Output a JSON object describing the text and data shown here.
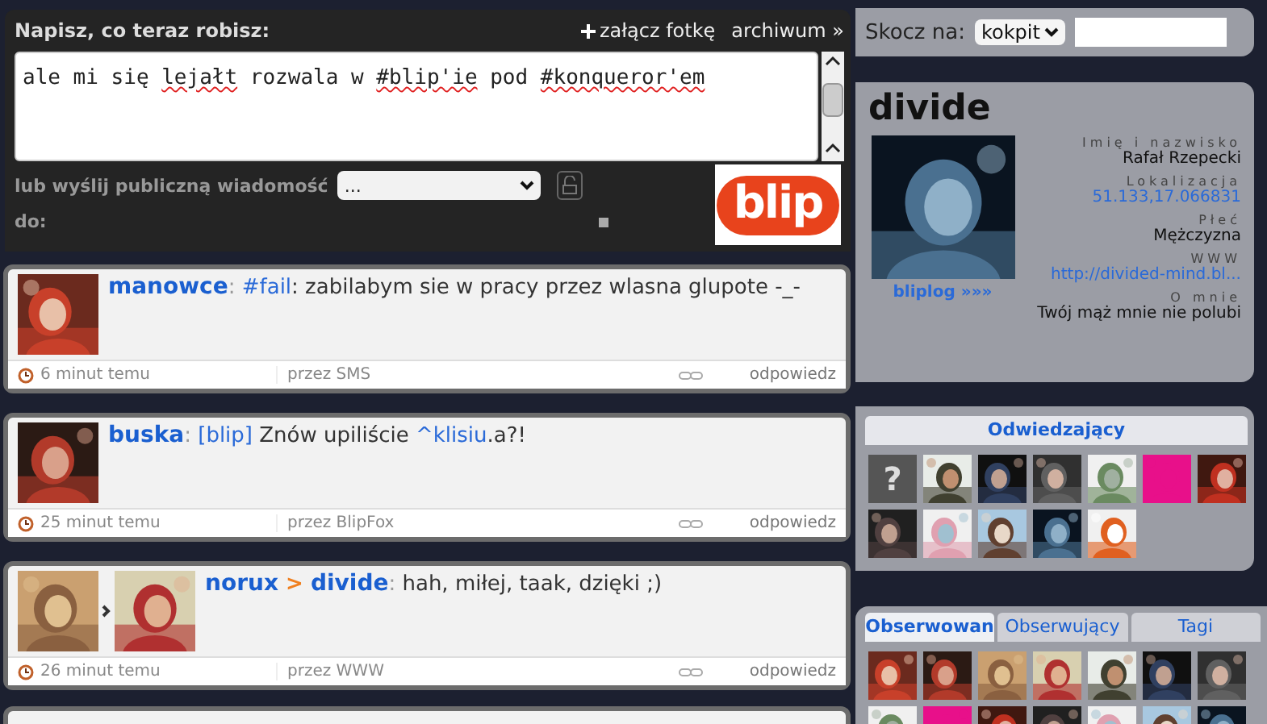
{
  "compose": {
    "title": "Napisz, co teraz robisz:",
    "attach": "załącz fotkę",
    "archive": "archiwum »",
    "message": [
      {
        "text": "ale mi się ",
        "misspelled": false
      },
      {
        "text": "lejałt",
        "misspelled": true
      },
      {
        "text": " rozwala w ",
        "misspelled": false
      },
      {
        "text": "#blip'ie",
        "misspelled": true
      },
      {
        "text": " pod ",
        "misspelled": false
      },
      {
        "text": "#konqueror'em",
        "misspelled": true
      }
    ],
    "recipient_label": "lub wyślij publiczną wiadomość",
    "recipient_select": "...",
    "to_label": "do:"
  },
  "logo": "blip",
  "posts": [
    {
      "avatars": [
        {
          "kind": "picture"
        }
      ],
      "message": [
        {
          "kind": "author",
          "text": "manowce"
        },
        {
          "kind": "sep",
          "text": ":"
        },
        {
          "kind": "link",
          "text": " #fail"
        },
        {
          "kind": "plain",
          "text": ": zabilabym sie w pracy przez wlasna glupote -_-"
        }
      ],
      "time": "6 minut temu",
      "source": "przez SMS",
      "reply": "odpowiedz"
    },
    {
      "avatars": [
        {
          "kind": "picture"
        }
      ],
      "message": [
        {
          "kind": "author",
          "text": "buska"
        },
        {
          "kind": "sep",
          "text": ":"
        },
        {
          "kind": "link",
          "text": " [blip]"
        },
        {
          "kind": "plain",
          "text": " Znów upiliście "
        },
        {
          "kind": "link",
          "text": "^klisiu"
        },
        {
          "kind": "plain",
          "text": ".a?!"
        }
      ],
      "time": "25 minut temu",
      "source": "przez BlipFox",
      "reply": "odpowiedz"
    },
    {
      "avatars": [
        {
          "kind": "picture"
        },
        {
          "kind": "picture"
        }
      ],
      "message": [
        {
          "kind": "author",
          "text": "norux"
        },
        {
          "kind": "arrow",
          "text": " > "
        },
        {
          "kind": "author",
          "text": "divide"
        },
        {
          "kind": "sep",
          "text": ":"
        },
        {
          "kind": "plain",
          "text": " hah, miłej, taak, dzięki ;)"
        }
      ],
      "time": "26 minut temu",
      "source": "przez WWW",
      "reply": "odpowiedz"
    }
  ],
  "jump": {
    "label": "Skocz na:",
    "select": "kokpit"
  },
  "profile": {
    "name": "divide",
    "bliplog": "bliplog »»»",
    "details": [
      {
        "label": "Imię i nazwisko",
        "value": "Rafał Rzepecki",
        "kind": "text"
      },
      {
        "label": "Lokalizacja",
        "value": "51.133,17.066831",
        "kind": "link"
      },
      {
        "label": "Płeć",
        "value": "Mężczyzna",
        "kind": "text"
      },
      {
        "label": "WWW",
        "value": "http://divided-mind.bl...",
        "kind": "link"
      },
      {
        "label": "O mnie",
        "value": "Twój mąż mnie nie polubi",
        "kind": "text"
      }
    ]
  },
  "visitors": {
    "title": "Odwiedzający",
    "avatars": [
      {
        "kind": "unknown",
        "label": "?"
      },
      {
        "kind": "picture"
      },
      {
        "kind": "picture"
      },
      {
        "kind": "picture"
      },
      {
        "kind": "picture"
      },
      {
        "kind": "picture"
      },
      {
        "kind": "picture"
      },
      {
        "kind": "picture"
      },
      {
        "kind": "picture"
      },
      {
        "kind": "picture"
      },
      {
        "kind": "picture"
      },
      {
        "kind": "picture"
      }
    ]
  },
  "tabs": [
    {
      "label": "Obserwowan",
      "selected": true
    },
    {
      "label": "Obserwujący",
      "selected": false
    },
    {
      "label": "Tagi",
      "selected": false
    }
  ],
  "following": {
    "avatars": [
      {
        "kind": "picture"
      },
      {
        "kind": "picture"
      },
      {
        "kind": "picture"
      },
      {
        "kind": "picture"
      },
      {
        "kind": "picture"
      },
      {
        "kind": "picture"
      },
      {
        "kind": "picture"
      },
      {
        "kind": "picture"
      },
      {
        "kind": "picture"
      },
      {
        "kind": "picture"
      },
      {
        "kind": "picture"
      },
      {
        "kind": "picture"
      },
      {
        "kind": "picture"
      },
      {
        "kind": "picture"
      }
    ]
  }
}
